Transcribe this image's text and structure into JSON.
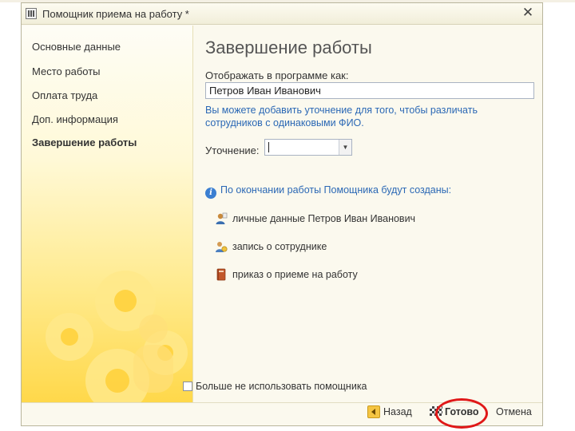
{
  "window": {
    "title": "Помощник приема на работу *",
    "close_symbol": "✕"
  },
  "sidebar": {
    "items": [
      {
        "label": "Основные данные",
        "active": false
      },
      {
        "label": "Место работы",
        "active": false
      },
      {
        "label": "Оплата труда",
        "active": false
      },
      {
        "label": "Доп. информация",
        "active": false
      },
      {
        "label": "Завершение работы",
        "active": true
      }
    ]
  },
  "main": {
    "title": "Завершение работы",
    "display_label": "Отображать в программе как:",
    "display_value": "Петров Иван Иванович",
    "hint": "Вы можете добавить уточнение для того, чтобы различать сотрудников с одинаковыми ФИО.",
    "clarification_label": "Уточнение:",
    "clarification_value": "",
    "info_text": "По окончании работы Помощника будут созданы:",
    "created_items": [
      {
        "icon": "person-data-icon",
        "label": "личные данные Петров Иван Иванович"
      },
      {
        "icon": "employee-record-icon",
        "label": "запись о сотруднике"
      },
      {
        "icon": "order-document-icon",
        "label": "приказ о приеме на работу"
      }
    ]
  },
  "footer": {
    "dont_use_label": "Больше не использовать помощника",
    "dont_use_checked": false,
    "back_label": "Назад",
    "done_label": "Готово",
    "cancel_label": "Отмена"
  },
  "colors": {
    "accent_blue": "#2b68b5",
    "highlight_red": "#e01818",
    "sidebar_gold": "#ffd84a"
  }
}
